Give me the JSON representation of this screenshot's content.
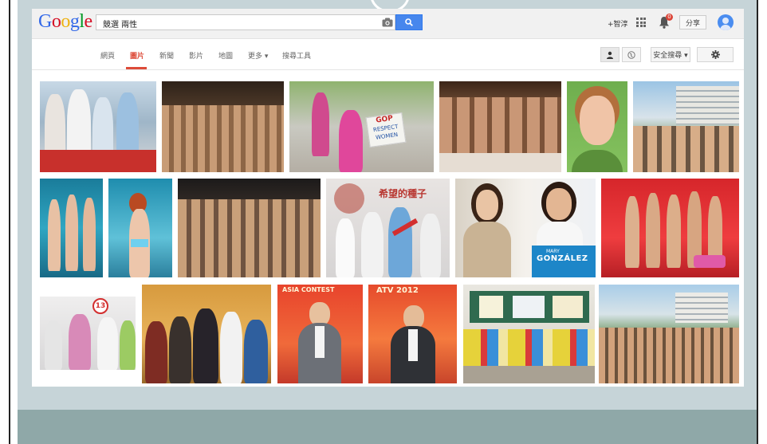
{
  "header": {
    "logo_letters": [
      "G",
      "o",
      "o",
      "g",
      "l",
      "e"
    ],
    "search_value": "競選 兩性",
    "plus_me": "+智淳",
    "notification_count": "0",
    "share_label": "分享"
  },
  "nav": {
    "tabs": [
      {
        "label": "網頁",
        "active": false
      },
      {
        "label": "圖片",
        "active": true
      },
      {
        "label": "新聞",
        "active": false
      },
      {
        "label": "影片",
        "active": false
      },
      {
        "label": "地圖",
        "active": false
      },
      {
        "label": "更多 ▾",
        "active": false
      },
      {
        "label": "搜尋工具",
        "active": false
      }
    ],
    "safe_search_label": "安全搜尋 ▾"
  },
  "results": {
    "image_texts": {
      "gop_sign_line1": "GOP",
      "gop_sign_line2": "RESPECT",
      "gop_sign_line3": "WOMEN",
      "seed_banner": "希望的種子",
      "poster_name_1": "MARY",
      "poster_name_2": "GONZÁLEZ",
      "number_badge": "13",
      "asia_contest_1": "ASIA CONTEST",
      "asia_contest_2": "ATV 2012"
    }
  },
  "colors": {
    "accent_red": "#dd4b39",
    "search_blue": "#4787ed",
    "slide_bg": "#c6d4d8",
    "slide_bottom": "#8fa8a8"
  }
}
